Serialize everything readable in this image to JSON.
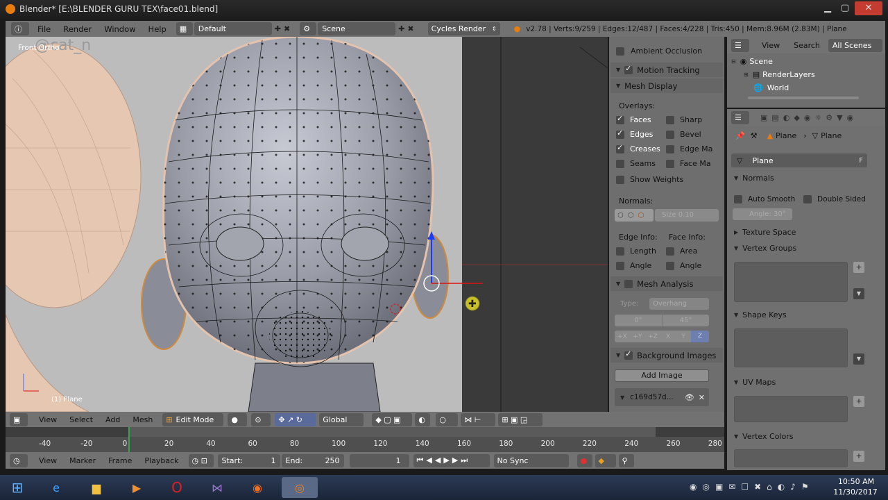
{
  "window": {
    "title": "Blender* [E:\\BLENDER GURU TEX\\face01.blend]"
  },
  "info_header": {
    "menus": [
      "File",
      "Render",
      "Window",
      "Help"
    ],
    "screen_layout": "Default",
    "scene": "Scene",
    "render_engine": "Cycles Render",
    "stats": "v2.78 | Verts:9/259 | Edges:12/487 | Faces:4/228 | Tris:450 | Mem:8.96M (2.83M) | Plane"
  },
  "viewport": {
    "view_label": "Front Ortho",
    "watermark": "@cat_n",
    "object_label": "(1) Plane"
  },
  "npanel": {
    "ambient_occlusion": "Ambient Occlusion",
    "motion_tracking": "Motion Tracking",
    "mesh_display": "Mesh Display",
    "overlays_label": "Overlays:",
    "overlays": [
      {
        "left": "Faces",
        "left_on": true,
        "right": "Sharp",
        "right_on": false
      },
      {
        "left": "Edges",
        "left_on": true,
        "right": "Bevel",
        "right_on": false
      },
      {
        "left": "Creases",
        "left_on": true,
        "right": "Edge Ma",
        "right_on": false
      },
      {
        "left": "Seams",
        "left_on": false,
        "right": "Face Ma",
        "right_on": false
      }
    ],
    "show_weights": "Show Weights",
    "normals_label": "Normals:",
    "normals_size": "Size  0.10",
    "edge_info": "Edge Info:",
    "face_info": "Face Info:",
    "info_rows": [
      {
        "left": "Length",
        "right": "Area"
      },
      {
        "left": "Angle",
        "right": "Angle"
      }
    ],
    "mesh_analysis": "Mesh Analysis",
    "type_label": "Type:",
    "type_value": "Overhang",
    "angle_min": "0°",
    "angle_max": "45°",
    "axes": [
      "+X",
      "+Y",
      "+Z",
      "X",
      "Y",
      "Z"
    ],
    "background_images": "Background Images",
    "add_image": "Add Image",
    "image_name": "c169d57d..."
  },
  "outliner": {
    "menus": [
      "View",
      "Search"
    ],
    "filter": "All Scenes",
    "items": [
      {
        "label": "Scene",
        "indent": 0
      },
      {
        "label": "RenderLayers",
        "indent": 1
      },
      {
        "label": "World",
        "indent": 1
      }
    ]
  },
  "properties": {
    "breadcrumb": [
      "Plane",
      "Plane"
    ],
    "datablock": "Plane",
    "fake_user": "F",
    "normals": "Normals",
    "auto_smooth": "Auto Smooth",
    "double_sided": "Double Sided",
    "angle": "Angle:  30°",
    "texture_space": "Texture Space",
    "vertex_groups": "Vertex Groups",
    "shape_keys": "Shape Keys",
    "uv_maps": "UV Maps",
    "vertex_colors": "Vertex Colors"
  },
  "viewport_header": {
    "menus": [
      "View",
      "Select",
      "Add",
      "Mesh"
    ],
    "mode": "Edit Mode",
    "orientation": "Global"
  },
  "timeline": {
    "ticks": [
      "-40",
      "-20",
      "0",
      "20",
      "40",
      "60",
      "80",
      "100",
      "120",
      "140",
      "160",
      "180",
      "200",
      "220",
      "240",
      "260",
      "280"
    ],
    "menus": [
      "View",
      "Marker",
      "Frame",
      "Playback"
    ],
    "start_label": "Start:",
    "start": "1",
    "end_label": "End:",
    "end": "250",
    "current": "1",
    "sync": "No Sync"
  },
  "taskbar": {
    "time": "10:50 AM",
    "date": "11/30/2017"
  }
}
